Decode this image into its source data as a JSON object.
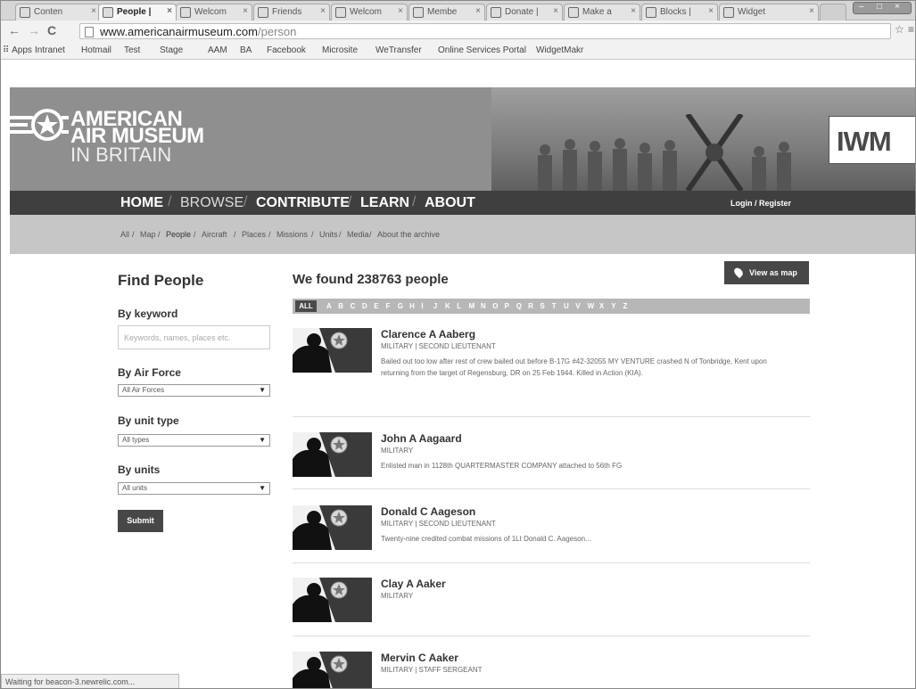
{
  "browser": {
    "tabs": [
      {
        "label": "Conten"
      },
      {
        "label": "People |",
        "active": true
      },
      {
        "label": "Welcom"
      },
      {
        "label": "Friends"
      },
      {
        "label": "Welcom"
      },
      {
        "label": "Membe"
      },
      {
        "label": "Donate |"
      },
      {
        "label": "Make a"
      },
      {
        "label": "Blocks |"
      },
      {
        "label": "Widget"
      }
    ],
    "url_host": "www.americanairmuseum.com",
    "url_path": "/person",
    "bookmarks": [
      "Apps",
      "Intranet",
      "Hotmail",
      "Test",
      "Stage",
      "AAM",
      "BA",
      "Facebook",
      "Microsite",
      "WeTransfer",
      "Online Services Portal",
      "WidgetMakr"
    ],
    "status": "Waiting for beacon-3.newrelic.com..."
  },
  "header": {
    "logo_line1": "AMERICAN",
    "logo_line2": "AIR MUSEUM",
    "logo_line3": "IN BRITAIN",
    "partner_logo": "IWM"
  },
  "mainnav": {
    "items": [
      "HOME",
      "BROWSE",
      "CONTRIBUTE",
      "LEARN",
      "ABOUT"
    ],
    "separator": "/",
    "login": "Login / Register"
  },
  "subnav": {
    "items": [
      "All",
      "Map",
      "People",
      "Aircraft",
      "Places",
      "Missions",
      "Units",
      "Media",
      "About the archive"
    ],
    "separator": "/"
  },
  "sidebar": {
    "title": "Find People",
    "keyword_label": "By keyword",
    "keyword_placeholder": "Keywords, names, places etc.",
    "airforce_label": "By Air Force",
    "airforce_value": "All Air Forces",
    "unittype_label": "By unit type",
    "unittype_value": "All types",
    "units_label": "By units",
    "units_value": "All units",
    "submit_label": "Submit"
  },
  "results": {
    "title": "We found 238763 people",
    "map_button": "View as map",
    "alpha_all": "ALL",
    "letters": [
      "A",
      "B",
      "C",
      "D",
      "E",
      "F",
      "G",
      "H",
      "I",
      "J",
      "K",
      "L",
      "M",
      "N",
      "O",
      "P",
      "Q",
      "R",
      "S",
      "T",
      "U",
      "V",
      "W",
      "X",
      "Y",
      "Z"
    ],
    "people": [
      {
        "name": "Clarence A Aaberg",
        "role": "MILITARY | SECOND LIEUTENANT",
        "desc": "Bailed out too low after rest of crew bailed out before B-17G #42-32055 MY VENTURE crashed N of Tonbridge, Kent upon returning from the target of Regensburg, DR on 25 Feb 1944. Killed in Action (KIA)."
      },
      {
        "name": "John A Aagaard",
        "role": "MILITARY",
        "desc": "Enlisted man in 1128th QUARTERMASTER COMPANY attached to 56th FG"
      },
      {
        "name": "Donald C Aageson",
        "role": "MILITARY | SECOND LIEUTENANT",
        "desc": "Twenty-nine credited combat missions of 1Lt Donald C. Aageson..."
      },
      {
        "name": "Clay A Aaker",
        "role": "MILITARY",
        "desc": ""
      },
      {
        "name": "Mervin C Aaker",
        "role": "MILITARY | STAFF SERGEANT",
        "desc": ""
      }
    ]
  }
}
